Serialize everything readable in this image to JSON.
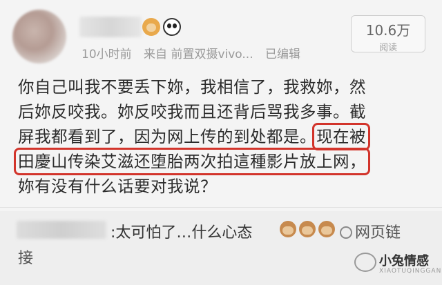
{
  "header": {
    "time": "10小时前",
    "source": "来自 前置双摄vivo...",
    "edited": "已编辑",
    "read_count": "10.6万",
    "read_label": "阅读"
  },
  "post": {
    "lines": [
      "你自己叫我不要丢下妳，我相信了，我救妳，然",
      "后妳反咬我。妳反咬我而且还背后骂我多事。截",
      "屏我都看到了，因为网上传的到处都是。",
      "田慶山传染艾滋还堕胎两次拍這種影片放上网，",
      "妳有没有什么话要对我说？"
    ],
    "highlight_a": "现在被",
    "highlight_b": "田慶山传染艾滋还堕胎两次拍這種影片放上网，"
  },
  "comment": {
    "text": ":太可怕了…什么心态",
    "link_label": "网页链",
    "link_cont": "接"
  },
  "watermark": {
    "title": "小兔情感",
    "sub": "XIAOTUQINGGAN"
  }
}
